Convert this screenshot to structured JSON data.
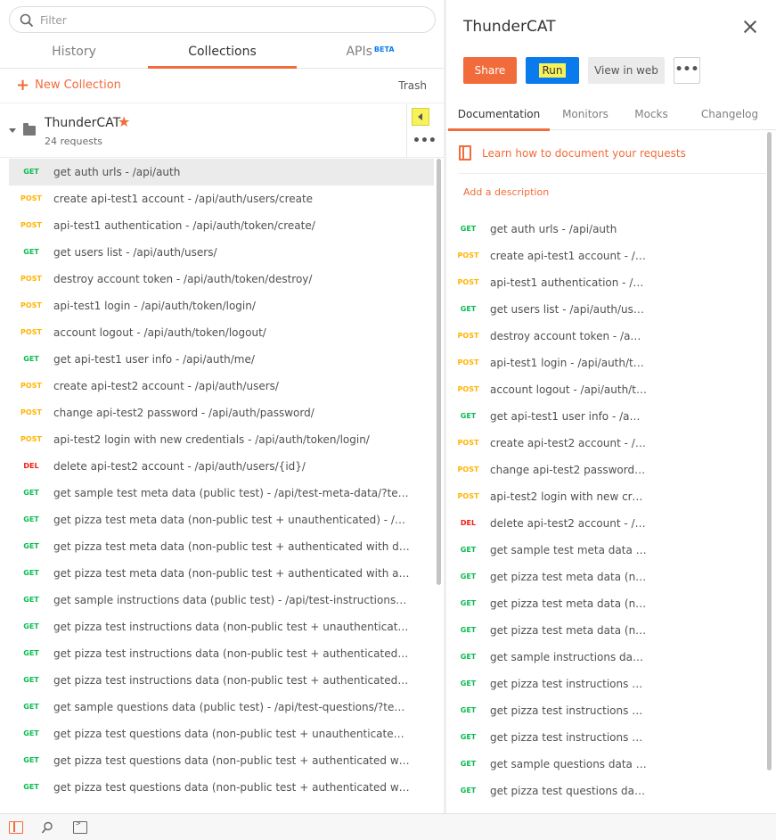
{
  "search": {
    "placeholder": "Filter"
  },
  "tabs": {
    "history": "History",
    "collections": "Collections",
    "apis": "APIs",
    "apis_badge": "BETA"
  },
  "actions": {
    "new_collection": "New Collection",
    "trash": "Trash"
  },
  "collection": {
    "name": "ThunderCAT",
    "count": "24 requests",
    "more": "•••"
  },
  "requests": [
    {
      "method": "GET",
      "title": "get auth urls - /api/auth"
    },
    {
      "method": "POST",
      "title": "create api-test1 account - /api/auth/users/create"
    },
    {
      "method": "POST",
      "title": "api-test1 authentication - /api/auth/token/create/"
    },
    {
      "method": "GET",
      "title": "get users list - /api/auth/users/"
    },
    {
      "method": "POST",
      "title": "destroy account token - /api/auth/token/destroy/"
    },
    {
      "method": "POST",
      "title": "api-test1 login - /api/auth/token/login/"
    },
    {
      "method": "POST",
      "title": "account logout - /api/auth/token/logout/"
    },
    {
      "method": "GET",
      "title": "get api-test1 user info - /api/auth/me/"
    },
    {
      "method": "POST",
      "title": "create api-test2 account - /api/auth/users/"
    },
    {
      "method": "POST",
      "title": "change api-test2 password - /api/auth/password/"
    },
    {
      "method": "POST",
      "title": "api-test2 login with new credentials - /api/auth/token/login/"
    },
    {
      "method": "DEL",
      "title": "delete api-test2 account - /api/auth/users/{id}/"
    },
    {
      "method": "GET",
      "title": "get sample test meta data (public test) - /api/test-meta-data/?test_na..."
    },
    {
      "method": "GET",
      "title": "get pizza test meta data (non-public test + unauthenticated) - /api/tes..."
    },
    {
      "method": "GET",
      "title": "get pizza test meta data (non-public test + authenticated with default ..."
    },
    {
      "method": "GET",
      "title": "get pizza test meta data (non-public test + authenticated with admin ..."
    },
    {
      "method": "GET",
      "title": "get sample instructions data (public test) - /api/test-instructions/?test..."
    },
    {
      "method": "GET",
      "title": "get pizza test instructions data (non-public test + unauthenticated) - /..."
    },
    {
      "method": "GET",
      "title": "get pizza test instructions data (non-public test + authenticated with ..."
    },
    {
      "method": "GET",
      "title": "get pizza test instructions data (non-public test + authenticated with ..."
    },
    {
      "method": "GET",
      "title": "get sample questions data (public test) - /api/test-questions/?test_na..."
    },
    {
      "method": "GET",
      "title": "get pizza test questions data (non-public test + unauthenticated) - /ap..."
    },
    {
      "method": "GET",
      "title": "get pizza test questions data (non-public test + authenticated with de..."
    },
    {
      "method": "GET",
      "title": "get pizza test questions data (non-public test + authenticated with ad..."
    }
  ],
  "right": {
    "title": "ThunderCAT",
    "buttons": {
      "share": "Share",
      "run": "Run",
      "view_web": "View in web",
      "more": "•••"
    },
    "tabs": {
      "documentation": "Documentation",
      "monitors": "Monitors",
      "mocks": "Mocks",
      "changelog": "Changelog"
    },
    "learn_link": "Learn how to document your requests",
    "add_description": "Add a description"
  },
  "doc_requests": [
    {
      "method": "GET",
      "title": "get auth urls - /api/auth"
    },
    {
      "method": "POST",
      "title": "create api-test1 account - /api..."
    },
    {
      "method": "POST",
      "title": "api-test1 authentication - /api..."
    },
    {
      "method": "GET",
      "title": "get users list - /api/auth/users/"
    },
    {
      "method": "POST",
      "title": "destroy account token - /api/a..."
    },
    {
      "method": "POST",
      "title": "api-test1 login - /api/auth/tok..."
    },
    {
      "method": "POST",
      "title": "account logout - /api/auth/tok..."
    },
    {
      "method": "GET",
      "title": "get api-test1 user info - /api/a..."
    },
    {
      "method": "POST",
      "title": "create api-test2 account - /api..."
    },
    {
      "method": "POST",
      "title": "change api-test2 password - /..."
    },
    {
      "method": "POST",
      "title": "api-test2 login with new crede..."
    },
    {
      "method": "DEL",
      "title": "delete api-test2 account - /api..."
    },
    {
      "method": "GET",
      "title": "get sample test meta data (pu..."
    },
    {
      "method": "GET",
      "title": "get pizza test meta data (non-..."
    },
    {
      "method": "GET",
      "title": "get pizza test meta data (non-..."
    },
    {
      "method": "GET",
      "title": "get pizza test meta data (non-..."
    },
    {
      "method": "GET",
      "title": "get sample instructions data (..."
    },
    {
      "method": "GET",
      "title": "get pizza test instructions dat..."
    },
    {
      "method": "GET",
      "title": "get pizza test instructions dat..."
    },
    {
      "method": "GET",
      "title": "get pizza test instructions dat..."
    },
    {
      "method": "GET",
      "title": "get sample questions data (p..."
    },
    {
      "method": "GET",
      "title": "get pizza test questions data (..."
    }
  ],
  "colors": {
    "accent": "#f26b3a",
    "run": "#097bed",
    "get": "#0cbb52",
    "post": "#ffb400",
    "del": "#eb2013",
    "highlight": "#f7f25a"
  },
  "icons": [
    "search-icon",
    "plus-icon",
    "caret-down-icon",
    "folder-icon",
    "star-icon",
    "collapse-arrow-icon",
    "more-icon",
    "close-icon",
    "document-icon",
    "sidebar-toggle-icon",
    "find-icon",
    "console-icon"
  ]
}
